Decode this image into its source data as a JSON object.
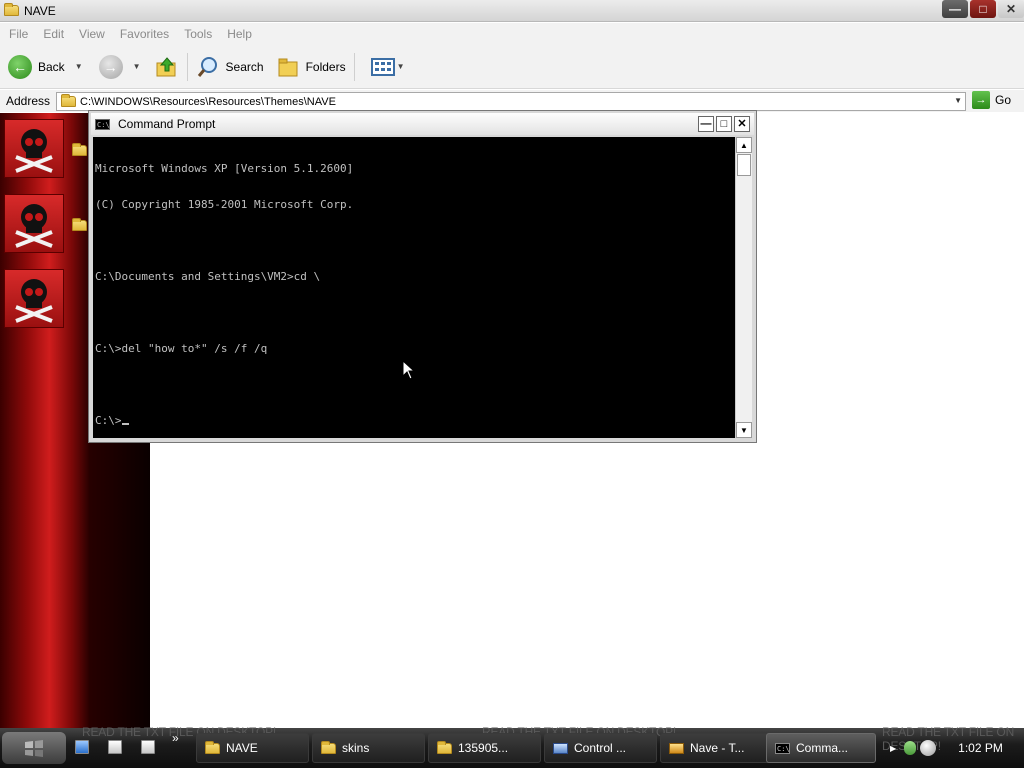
{
  "window": {
    "title": "NAVE",
    "min_glyph": "—",
    "max_glyph": "□",
    "close_glyph": "✕"
  },
  "menu": [
    "File",
    "Edit",
    "View",
    "Favorites",
    "Tools",
    "Help"
  ],
  "toolbar": {
    "back_label": "Back",
    "search_label": "Search",
    "folders_label": "Folders"
  },
  "address": {
    "label": "Address",
    "value": "C:\\WINDOWS\\Resources\\Resources\\Themes\\NAVE",
    "go_label": "Go"
  },
  "cmd": {
    "title": "Command Prompt",
    "icon_text": "C:\\",
    "lines": [
      "Microsoft Windows XP [Version 5.1.2600]",
      "(C) Copyright 1985-2001 Microsoft Corp.",
      "",
      "C:\\Documents and Settings\\VM2>cd \\",
      "",
      "C:\\>del \"how to*\" /s /f /q",
      "",
      "C:\\>"
    ]
  },
  "taskbar": {
    "banner_text": "READ THE TXT FILE ON DESKTOP!",
    "overflow_glyph": "»",
    "items": [
      {
        "label": "NAVE",
        "icon": "folder-icon"
      },
      {
        "label": "skins",
        "icon": "folder-icon"
      },
      {
        "label": "135905...",
        "icon": "folder-icon"
      },
      {
        "label": "Control ...",
        "icon": "control-panel-icon"
      },
      {
        "label": "Nave - T...",
        "icon": "paint-icon"
      },
      {
        "label": "Comma...",
        "icon": "cmd-icon"
      }
    ],
    "clock": "1:02 PM"
  }
}
